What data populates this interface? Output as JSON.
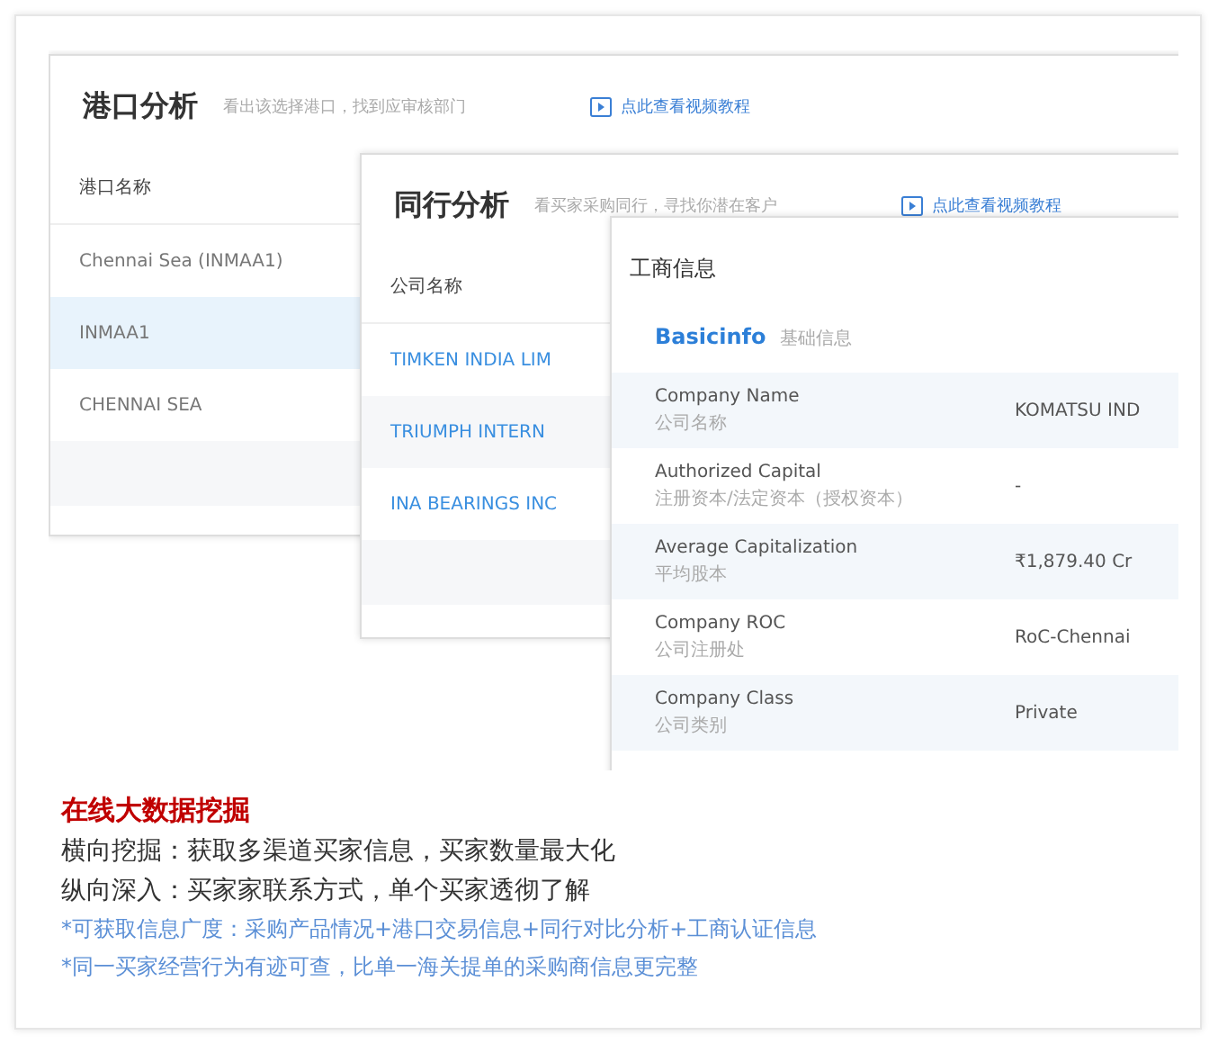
{
  "port_panel": {
    "title": "港口分析",
    "subtitle": "看出该选择港口，找到应审核部门",
    "link": "点此查看视频教程",
    "column": "港口名称",
    "rows": [
      {
        "name": "Chennai Sea (INMAA1)",
        "selected": false
      },
      {
        "name": "INMAA1",
        "selected": true
      },
      {
        "name": "CHENNAI SEA",
        "selected": false
      }
    ]
  },
  "peer_panel": {
    "title": "同行分析",
    "subtitle": "看买家采购同行，寻找你潜在客户",
    "link": "点此查看视频教程",
    "column": "公司名称",
    "rows": [
      {
        "name": "TIMKEN INDIA LIM"
      },
      {
        "name": "TRIUMPH INTERN"
      },
      {
        "name": "INA BEARINGS INC"
      }
    ]
  },
  "business_panel": {
    "title": "工商信息",
    "section": "Basicinfo",
    "section_note": "基础信息",
    "rows": [
      {
        "label": "Company Name",
        "label_cn": "公司名称",
        "value": "KOMATSU IND"
      },
      {
        "label": "Authorized Capital",
        "label_cn": "注册资本/法定资本（授权资本）",
        "value": "-"
      },
      {
        "label": "Average Capitalization",
        "label_cn": "平均股本",
        "value": "₹1,879.40 Cr"
      },
      {
        "label": "Company ROC",
        "label_cn": "公司注册处",
        "value": "RoC-Chennai"
      },
      {
        "label": "Company Class",
        "label_cn": "公司类别",
        "value": "Private"
      }
    ]
  },
  "caption": {
    "heading": "在线大数据挖掘",
    "lines": [
      "横向挖掘：获取多渠道买家信息，买家数量最大化",
      "纵向深入：买家家联系方式，单个买家透彻了解"
    ],
    "notes": [
      "*可获取信息广度：采购产品情况+港口交易信息+同行对比分析+工商认证信息",
      "*同一买家经营行为有迹可查，比单一海关提单的采购商信息更完整"
    ]
  }
}
